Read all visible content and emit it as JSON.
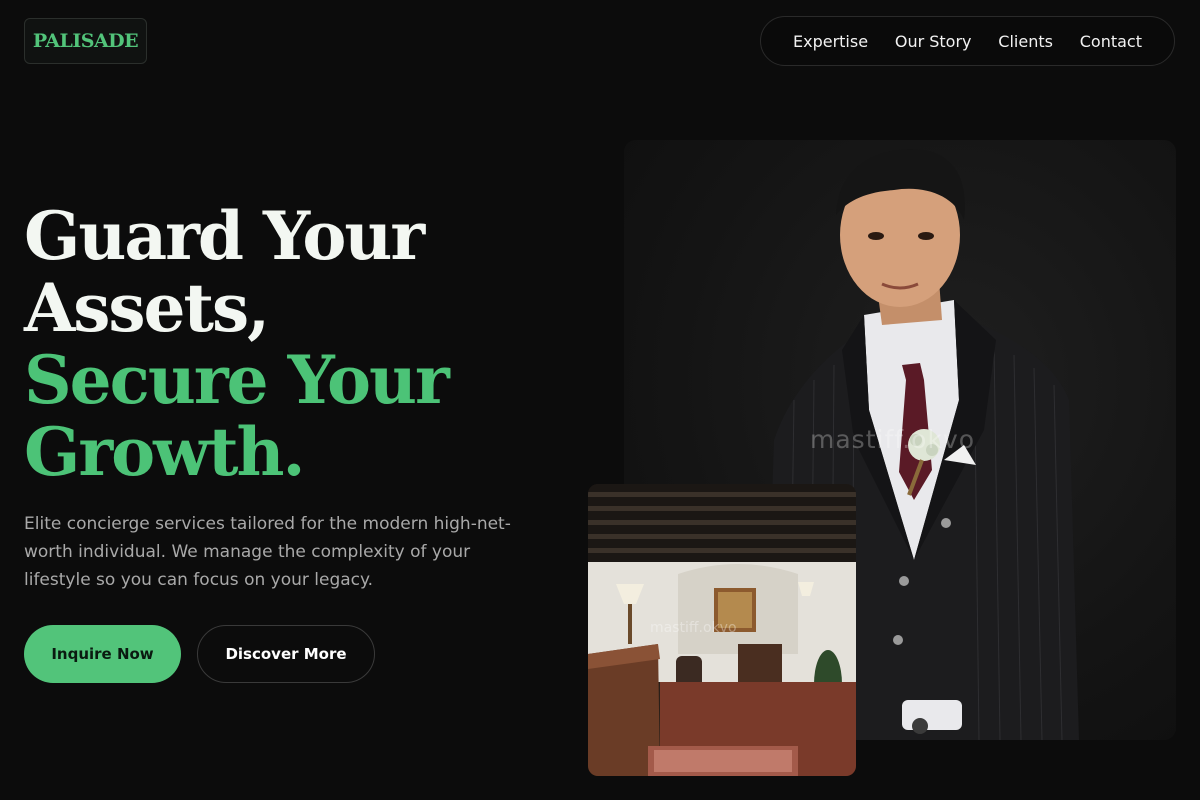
{
  "brand": {
    "name": "PALISADE"
  },
  "nav": {
    "items": [
      {
        "label": "Expertise"
      },
      {
        "label": "Our Story"
      },
      {
        "label": "Clients"
      },
      {
        "label": "Contact"
      }
    ]
  },
  "hero": {
    "headline_line1": "Guard Your",
    "headline_line2": "Assets,",
    "headline_line3": "Secure Your",
    "headline_line4": "Growth.",
    "description": "Elite concierge services tailored for the modern high-net-worth individual. We manage the complexity of your lifestyle so you can focus on your legacy.",
    "primary_cta": "Inquire Now",
    "secondary_cta": "Discover More"
  },
  "images": {
    "portrait_watermark": "mastiff.okvo",
    "lobby_watermark": "mastiff.okvo"
  },
  "colors": {
    "accent": "#52c47a",
    "background": "#0c0c0c",
    "headline_white": "#f3f7f2",
    "body_text": "#a9a9a9"
  }
}
